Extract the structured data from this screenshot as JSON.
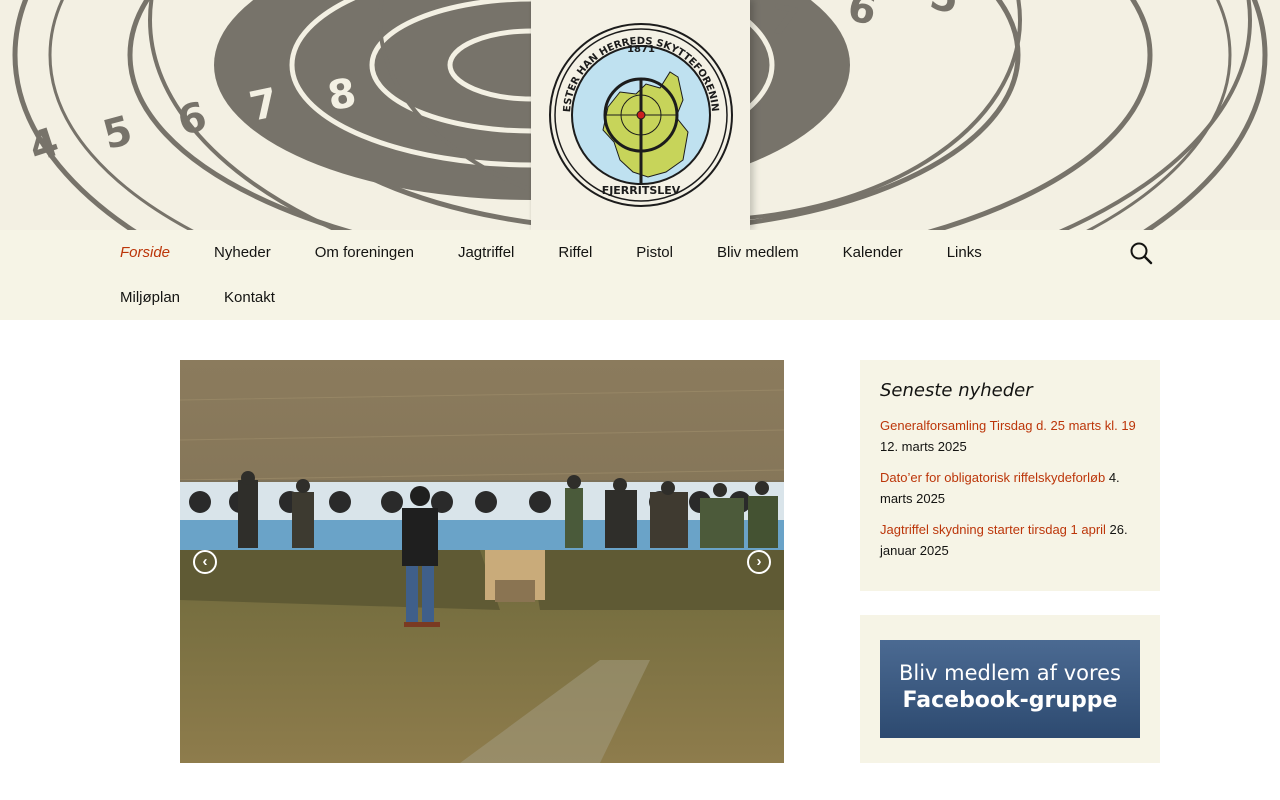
{
  "header": {
    "background_color": "#f3f0e3",
    "target_color": "#77736a",
    "target_numbers": [
      "4",
      "5",
      "6",
      "7",
      "8",
      "8",
      "7",
      "6",
      "5"
    ],
    "logo": {
      "circle_text": "VESTER HAN HERREDS SKYTTEFORENING",
      "year": "1871",
      "bottom_text": "FJERRITSLEV"
    }
  },
  "nav": {
    "items": [
      {
        "label": "Forside",
        "current": true
      },
      {
        "label": "Nyheder"
      },
      {
        "label": "Om foreningen"
      },
      {
        "label": "Jagtriffel"
      },
      {
        "label": "Riffel"
      },
      {
        "label": "Pistol"
      },
      {
        "label": "Bliv medlem"
      },
      {
        "label": "Kalender"
      },
      {
        "label": "Links"
      },
      {
        "label": "Miljøplan"
      },
      {
        "label": "Kontakt"
      }
    ],
    "search_icon": "search-icon",
    "accent_color": "#bc360a"
  },
  "slider": {
    "prev_icon": "chevron-left-icon",
    "next_icon": "chevron-right-icon",
    "prev_glyph": "‹",
    "next_glyph": "›"
  },
  "sidebar": {
    "news_widget": {
      "title": "Seneste nyheder",
      "items": [
        {
          "title": "Generalforsamling Tirsdag d. 25 marts kl. 19",
          "date": "12. marts 2025"
        },
        {
          "title": "Dato’er for obligatorisk riffelskydeforløb",
          "date": "4. marts 2025"
        },
        {
          "title": "Jagtriffel skydning starter tirsdag 1 april",
          "date": "26. januar 2025"
        }
      ]
    },
    "facebook_widget": {
      "line1": "Bliv medlem af vores",
      "line2": "Facebook-gruppe",
      "color": "#3a5a82"
    }
  }
}
